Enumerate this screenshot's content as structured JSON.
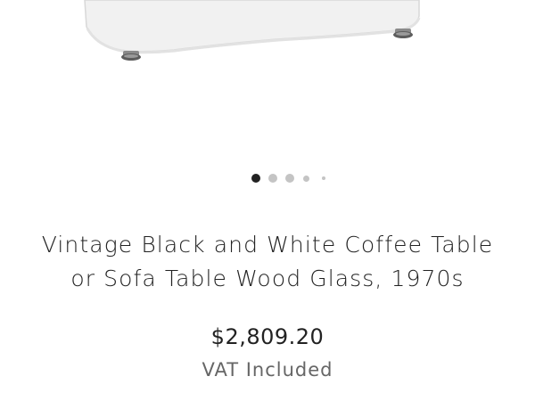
{
  "product": {
    "title_line1": "Vintage Black and White Coffee Table",
    "title_line2": "or Sofa Table Wood Glass, 1970s",
    "price": "$2,809.20",
    "vat_note": "VAT Included"
  },
  "carousel": {
    "total_images": 5,
    "active_index": 0
  },
  "colors": {
    "active_dot": "#222222",
    "inactive_dot": "#c4c4c4",
    "text_primary": "#222222",
    "text_secondary": "#666666"
  }
}
